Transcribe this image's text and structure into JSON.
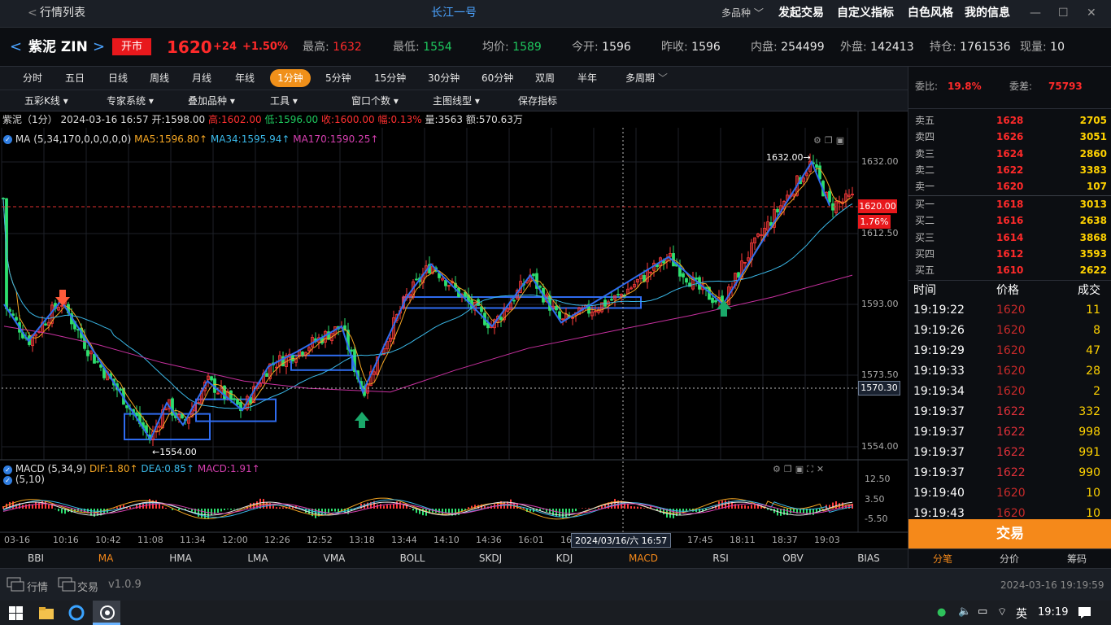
{
  "titlebar": {
    "back_label": "行情列表",
    "center_title": "长江一号",
    "multi": "多品种",
    "menu": [
      "发起交易",
      "自定义指标",
      "白色风格",
      "我的信息"
    ]
  },
  "quote": {
    "name": "紫泥 ZIN",
    "status": "开市",
    "price": "1620",
    "change": "+24",
    "change_pct": "+1.50%",
    "stats": [
      {
        "k": "最高:",
        "v": "1632"
      },
      {
        "k": "最低:",
        "v": "1554"
      },
      {
        "k": "均价:",
        "v": "1589"
      },
      {
        "k": "今开:",
        "v": "1596"
      },
      {
        "k": "昨收:",
        "v": "1596"
      },
      {
        "k": "内盘:",
        "v": "254499"
      },
      {
        "k": "外盘:",
        "v": "142413"
      },
      {
        "k": "持仓:",
        "v": "1761536"
      },
      {
        "k": "现量:",
        "v": "10"
      }
    ]
  },
  "periods": [
    "分时",
    "五日",
    "日线",
    "周线",
    "月线",
    "年线",
    "1分钟",
    "5分钟",
    "15分钟",
    "30分钟",
    "60分钟",
    "双周",
    "半年",
    "多周期"
  ],
  "tools": [
    "五彩K线",
    "专家系统",
    "叠加品种",
    "工具",
    "窗口个数",
    "主图线型",
    "保存指标"
  ],
  "chart_info": {
    "name": "紫泥（1分）",
    "datetime": "2024-03-16 16:57",
    "open": "开:1598.00",
    "high": "高:1602.00",
    "low": "低:1596.00",
    "close": "收:1600.00",
    "amp": "幅:0.13%",
    "vol": "量:3563",
    "amt": "额:570.63万"
  },
  "ma": {
    "label": "MA (5,34,170,0,0,0,0,0)",
    "ma5": "MA5:1596.80↑",
    "ma34": "MA34:1595.94↑",
    "ma170": "MA170:1590.25↑"
  },
  "macd": {
    "label": "MACD (5,34,9)",
    "dif": "DIF:1.80↑",
    "dea": "DEA:0.85↑",
    "macd": "MACD:1.91↑",
    "sub": "(5,10)"
  },
  "main_axis": [
    "1632.00",
    "1612.50",
    "1593.00",
    "1573.50",
    "1554.00"
  ],
  "macd_axis": [
    "12.50",
    "3.50",
    "-5.50"
  ],
  "price_tag": "1620.00",
  "pct_tag": "1.76%",
  "cursor_tag": "1570.30",
  "high_label": "1632.00→",
  "low_label": "←1554.00",
  "time_axis": [
    "03-16",
    "10:16",
    "10:42",
    "11:08",
    "11:34",
    "12:00",
    "12:26",
    "12:52",
    "13:18",
    "13:44",
    "14:10",
    "14:36",
    "16:01",
    "16:27",
    "17:45",
    "18:11",
    "18:37",
    "19:03"
  ],
  "cursor_time": "2024/03/16/六  16:57",
  "chart_data": {
    "type": "candlestick",
    "ylim": [
      1554,
      1632
    ],
    "x": [
      "03-16",
      "10:16",
      "10:42",
      "11:08",
      "11:34",
      "12:00",
      "12:26",
      "12:52",
      "13:18",
      "13:44",
      "14:10",
      "14:36",
      "16:01",
      "16:27",
      "17:45",
      "18:11",
      "18:37",
      "19:03"
    ],
    "close": [
      1596,
      1590,
      1575,
      1559,
      1561,
      1566,
      1572,
      1579,
      1568,
      1588,
      1598,
      1594,
      1598,
      1598,
      1599,
      1596,
      1622,
      1620
    ]
  },
  "indicators": [
    "BBI",
    "MA",
    "HMA",
    "LMA",
    "VMA",
    "BOLL",
    "SKDJ",
    "KDJ",
    "MACD",
    "RSI",
    "OBV",
    "BIAS"
  ],
  "right": {
    "wb_label": "委比:",
    "wb": "19.8%",
    "wc_label": "委差:",
    "wc": "75793",
    "sells": [
      {
        "n": "卖五",
        "p": "1628",
        "v": "2705"
      },
      {
        "n": "卖四",
        "p": "1626",
        "v": "3051"
      },
      {
        "n": "卖三",
        "p": "1624",
        "v": "2860"
      },
      {
        "n": "卖二",
        "p": "1622",
        "v": "3383"
      },
      {
        "n": "卖一",
        "p": "1620",
        "v": "107"
      }
    ],
    "buys": [
      {
        "n": "买一",
        "p": "1618",
        "v": "3013"
      },
      {
        "n": "买二",
        "p": "1616",
        "v": "2638"
      },
      {
        "n": "买三",
        "p": "1614",
        "v": "3868"
      },
      {
        "n": "买四",
        "p": "1612",
        "v": "3593"
      },
      {
        "n": "买五",
        "p": "1610",
        "v": "2622"
      }
    ],
    "tick_head": [
      "时间",
      "价格",
      "成交"
    ],
    "ticks": [
      {
        "t": "19:19:22",
        "p": "1620",
        "v": "11"
      },
      {
        "t": "19:19:26",
        "p": "1620",
        "v": "8"
      },
      {
        "t": "19:19:29",
        "p": "1620",
        "v": "47"
      },
      {
        "t": "19:19:33",
        "p": "1620",
        "v": "28"
      },
      {
        "t": "19:19:34",
        "p": "1620",
        "v": "2"
      },
      {
        "t": "19:19:37",
        "p": "1622",
        "v": "332"
      },
      {
        "t": "19:19:37",
        "p": "1622",
        "v": "998"
      },
      {
        "t": "19:19:37",
        "p": "1622",
        "v": "991"
      },
      {
        "t": "19:19:37",
        "p": "1622",
        "v": "990"
      },
      {
        "t": "19:19:40",
        "p": "1620",
        "v": "10"
      },
      {
        "t": "19:19:43",
        "p": "1620",
        "v": "10"
      }
    ],
    "trade": "交易",
    "tabs": [
      "分笔",
      "分价",
      "筹码"
    ]
  },
  "status": {
    "tab1": "行情",
    "tab2": "交易",
    "version": "v1.0.9",
    "datetime": "2024-03-16 19:19:59"
  },
  "taskbar": {
    "ime": "英",
    "clock": "19:19"
  }
}
